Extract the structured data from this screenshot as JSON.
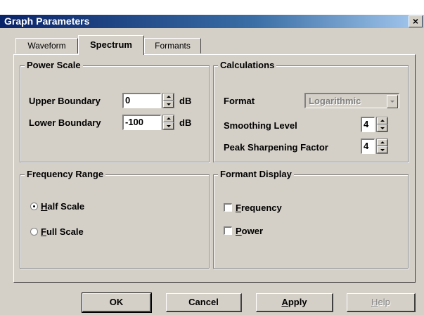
{
  "window": {
    "title": "Graph Parameters",
    "close_glyph": "×"
  },
  "tabs": [
    {
      "label": "Waveform",
      "active": false
    },
    {
      "label": "Spectrum",
      "active": true
    },
    {
      "label": "Formants",
      "active": false
    }
  ],
  "power_scale": {
    "legend": "Power Scale",
    "upper": {
      "label": "Upper Boundary",
      "value": "0",
      "unit": "dB"
    },
    "lower": {
      "label": "Lower Boundary",
      "value": "-100",
      "unit": "dB"
    }
  },
  "calculations": {
    "legend": "Calculations",
    "format": {
      "label": "Format",
      "value": "Logarithmic",
      "enabled": false
    },
    "smoothing": {
      "label": "Smoothing Level",
      "value": "4"
    },
    "peak": {
      "label": "Peak Sharpening Factor",
      "value": "4"
    }
  },
  "frequency_range": {
    "legend": "Frequency Range",
    "half": {
      "label_mnemonic": "H",
      "label_rest": "alf Scale",
      "selected": true
    },
    "full": {
      "label_mnemonic": "F",
      "label_rest": "ull Scale",
      "selected": false
    }
  },
  "formant_display": {
    "legend": "Formant Display",
    "frequency": {
      "label_mnemonic": "F",
      "label_rest": "requency",
      "checked": false
    },
    "power": {
      "label_mnemonic": "P",
      "label_rest": "ower",
      "checked": false
    }
  },
  "buttons": {
    "ok": "OK",
    "cancel": "Cancel",
    "apply_mnemonic": "A",
    "apply_rest": "pply",
    "help_mnemonic": "H",
    "help_rest": "elp"
  },
  "colors": {
    "face": "#d4d0c8",
    "title_start": "#0a246a",
    "title_end": "#a6caf0"
  }
}
